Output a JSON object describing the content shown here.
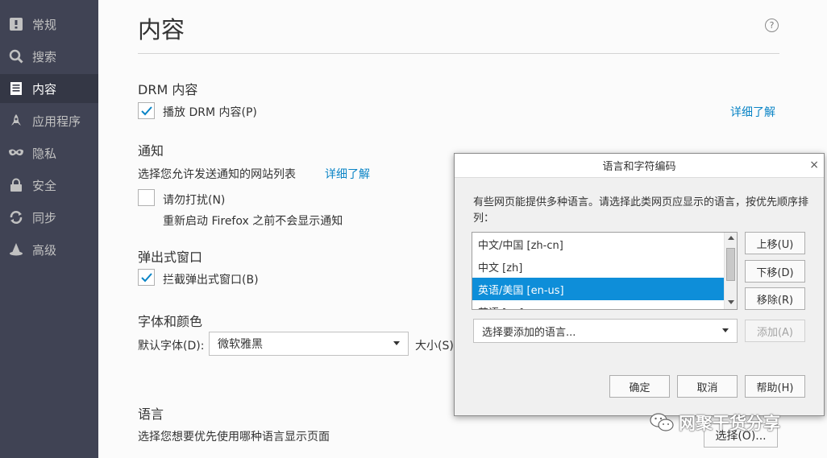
{
  "sidebar": {
    "items": [
      {
        "label": "常规",
        "icon": "general-icon",
        "active": false
      },
      {
        "label": "搜索",
        "icon": "search-icon",
        "active": false
      },
      {
        "label": "内容",
        "icon": "content-icon",
        "active": true
      },
      {
        "label": "应用程序",
        "icon": "rocket-icon",
        "active": false
      },
      {
        "label": "隐私",
        "icon": "mask-icon",
        "active": false
      },
      {
        "label": "安全",
        "icon": "lock-icon",
        "active": false
      },
      {
        "label": "同步",
        "icon": "sync-icon",
        "active": false
      },
      {
        "label": "高级",
        "icon": "wizard-hat-icon",
        "active": false
      }
    ]
  },
  "main": {
    "title": "内容",
    "help_icon": "?",
    "drm": {
      "heading": "DRM 内容",
      "checkbox_label": "播放 DRM 内容(P)",
      "checked": true,
      "learn_more": "详细了解"
    },
    "notifications": {
      "heading": "通知",
      "description": "选择您允许发送通知的网站列表",
      "learn_more": "详细了解",
      "dnd_label": "请勿打扰(N)",
      "dnd_checked": false,
      "dnd_note": "重新启动 Firefox 之前不会显示通知"
    },
    "popups": {
      "heading": "弹出式窗口",
      "checkbox_label": "拦截弹出式窗口(B)",
      "checked": true
    },
    "fonts": {
      "heading": "字体和颜色",
      "default_font_label": "默认字体(D):",
      "default_font_value": "微软雅黑",
      "size_label": "大小(S)"
    },
    "language": {
      "heading": "语言",
      "description": "选择您想要优先使用哪种语言显示页面",
      "choose_button": "选择(O)..."
    }
  },
  "dialog": {
    "title": "语言和字符编码",
    "close": "×",
    "description": "有些网页能提供多种语言。请选择此类网页应显示的语言，按优先顺序排列：",
    "languages": [
      {
        "label": "中文/中国  [zh-cn]",
        "selected": false
      },
      {
        "label": "中文  [zh]",
        "selected": false
      },
      {
        "label": "英语/美国  [en-us]",
        "selected": true
      },
      {
        "label": "英语  [en]",
        "selected": false
      }
    ],
    "move_up": "上移(U)",
    "move_down": "下移(D)",
    "remove": "移除(R)",
    "add_select_placeholder": "选择要添加的语言...",
    "add_button": "添加(A)",
    "ok": "确定",
    "cancel": "取消",
    "help": "帮助(H)"
  },
  "watermark": {
    "text": "网聚干货分享"
  },
  "colors": {
    "sidebar_bg": "#404354",
    "sidebar_active": "#343745",
    "link": "#0a84c6",
    "selection": "#0e8ed9",
    "check": "#0a84c6"
  }
}
